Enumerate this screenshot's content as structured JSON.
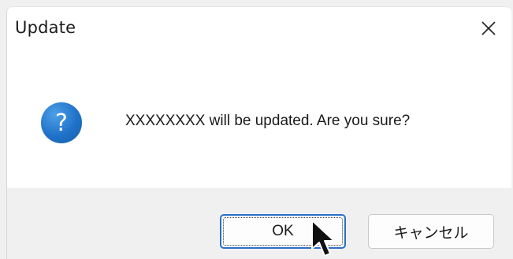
{
  "dialog": {
    "title": "Update",
    "close_glyph": "✕",
    "icon": "question-icon",
    "icon_glyph": "?",
    "message": "XXXXXXXX will be updated. Are you sure?",
    "ok_label": "OK",
    "cancel_label": "キャンセル",
    "accent": "#2a6fc9",
    "icon_color": "#1f72c9"
  },
  "cursor": {
    "icon": "arrow-cursor-icon"
  }
}
